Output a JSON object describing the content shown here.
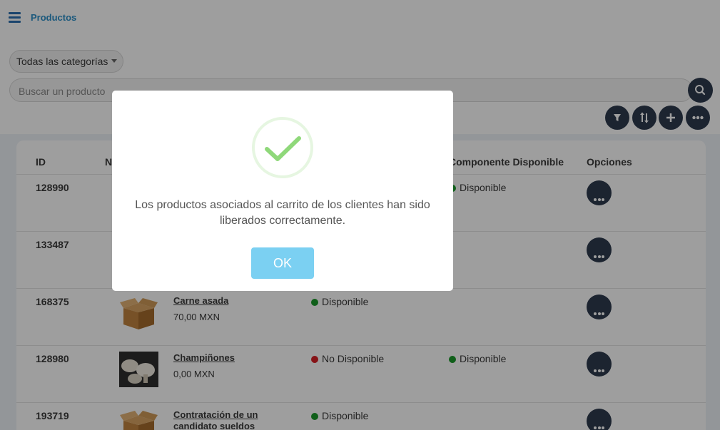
{
  "header": {
    "title": "Productos"
  },
  "filters": {
    "category_label": "Todas las categorías",
    "search_placeholder": "Buscar un producto"
  },
  "table": {
    "columns": [
      "ID",
      "N",
      "Componente Disponible",
      "Opciones"
    ],
    "rows": [
      {
        "id": "128990",
        "name": "",
        "price": "",
        "status": "",
        "component": "Disponible",
        "component_color": "green"
      },
      {
        "id": "133487",
        "name": "",
        "price": "",
        "status": "",
        "component": ""
      },
      {
        "id": "168375",
        "name": "Carne asada",
        "price": "70,00 MXN",
        "status": "Disponible",
        "status_color": "green",
        "component": "",
        "image": "box-icon"
      },
      {
        "id": "128980",
        "name": "Champiñones",
        "price": "0,00 MXN",
        "status": "No Disponible",
        "status_color": "red",
        "component": "Disponible",
        "component_color": "green",
        "image": "mushrooms-photo"
      },
      {
        "id": "193719",
        "name": "Contratación de un candidato sueldos entre",
        "price": "",
        "status": "Disponible",
        "status_color": "green",
        "component": "",
        "image": "box-icon"
      }
    ]
  },
  "modal": {
    "message": "Los productos asociados al carrito de los clientes han sido liberados correctamente.",
    "ok_label": "OK"
  },
  "colors": {
    "accent": "#2a8fc8",
    "dark_button": "#2e3a4e",
    "ok_button": "#7bd0f2",
    "success": "#8fd87a"
  }
}
